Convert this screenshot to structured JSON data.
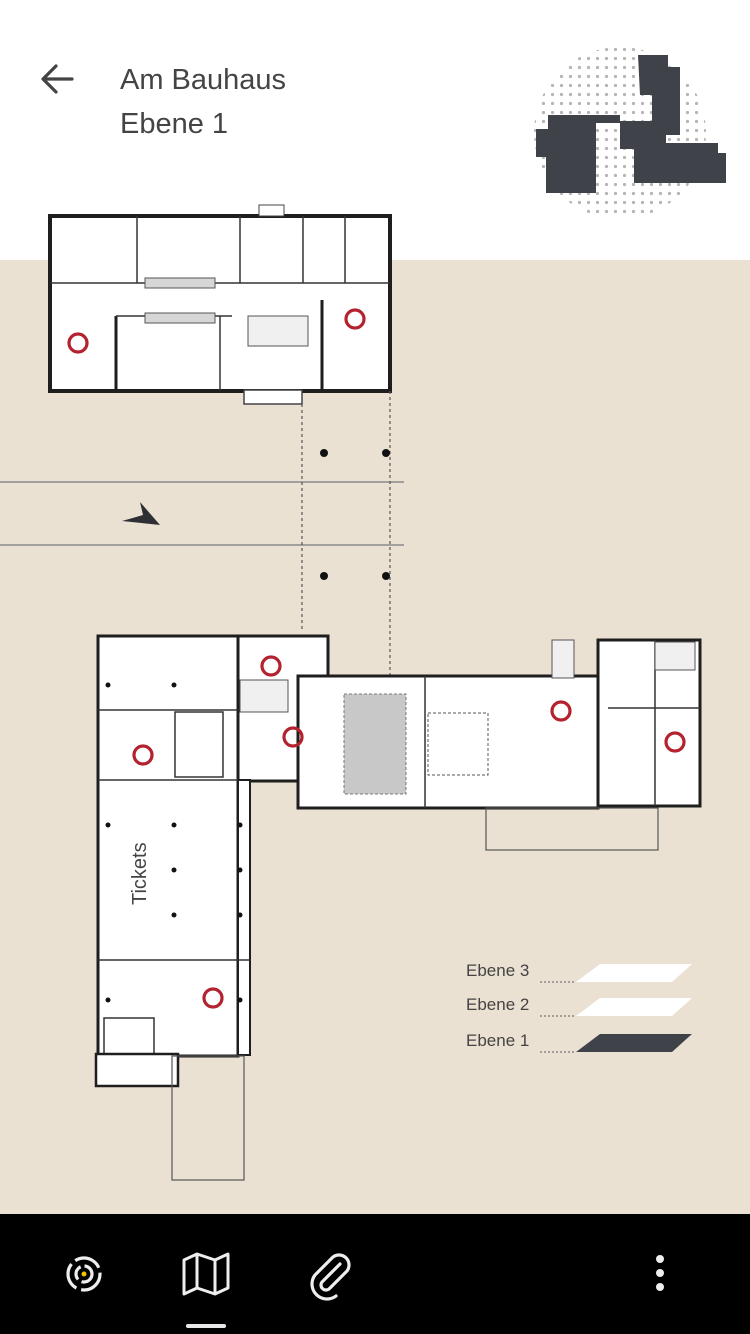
{
  "header": {
    "title_line1": "Am Bauhaus",
    "title_line2": "Ebene 1"
  },
  "map": {
    "room_label": "Tickets",
    "background_color": "#ebe1d3",
    "poi_color": "#b3222e"
  },
  "levels": [
    {
      "label": "Ebene 3",
      "active": false
    },
    {
      "label": "Ebene 2",
      "active": false
    },
    {
      "label": "Ebene 1",
      "active": true
    }
  ],
  "bottom_nav": {
    "items": [
      {
        "icon": "target-icon"
      },
      {
        "icon": "map-icon",
        "active": true
      },
      {
        "icon": "paperclip-icon"
      },
      {
        "icon": "more-vertical-icon"
      }
    ]
  }
}
